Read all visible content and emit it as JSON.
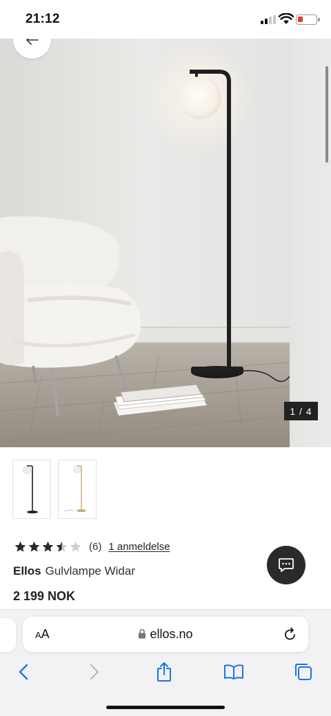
{
  "status_bar": {
    "time": "21:12",
    "battery": "low"
  },
  "gallery": {
    "counter": "1 / 4",
    "back_icon": "arrow-left-icon",
    "colors": {
      "wall": "#e9e8e6",
      "floor": "#a9a197",
      "lamp": "#1f1f1f"
    }
  },
  "thumbnails": [
    {
      "variant": "black lamp"
    },
    {
      "variant": "brass lamp"
    }
  ],
  "rating": {
    "stars": 3.5,
    "max_stars": 5,
    "count": "(6)",
    "reviews_link": "1 anmeldelse"
  },
  "product": {
    "brand": "Ellos",
    "name": "Gulvlampe Widar",
    "price": "2 199 NOK"
  },
  "chat_button": {
    "icon": "chat-bubble-icon"
  },
  "browser": {
    "text_size_label": "AA",
    "url": "ellos.no",
    "icons": [
      "back-icon",
      "forward-icon",
      "share-icon",
      "bookmarks-icon",
      "tabs-icon"
    ]
  }
}
